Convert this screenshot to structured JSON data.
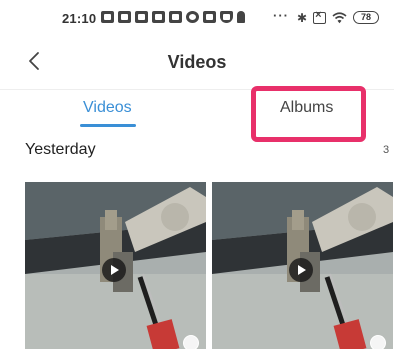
{
  "status_bar": {
    "time": "21:10",
    "more": "···",
    "bluetooth": "✱",
    "battery": "78",
    "icons": [
      "message-icon",
      "message-icon",
      "message-icon",
      "message-icon",
      "message-icon",
      "check-circle-icon",
      "image-icon",
      "shield-icon",
      "person-icon",
      "bluetooth-icon",
      "sim-off-icon",
      "wifi-icon",
      "battery-icon"
    ]
  },
  "header": {
    "back_icon": "chevron-left-icon",
    "title": "Videos"
  },
  "tabs": [
    {
      "label": "Videos",
      "active": true
    },
    {
      "label": "Albums",
      "active": false
    }
  ],
  "colors": {
    "accent": "#3a8fd6",
    "highlight": "#e8306a"
  },
  "section": {
    "title": "Yesterday",
    "count": "3"
  },
  "thumbnails": [
    {
      "icon": "play-icon"
    },
    {
      "icon": "play-icon"
    }
  ]
}
